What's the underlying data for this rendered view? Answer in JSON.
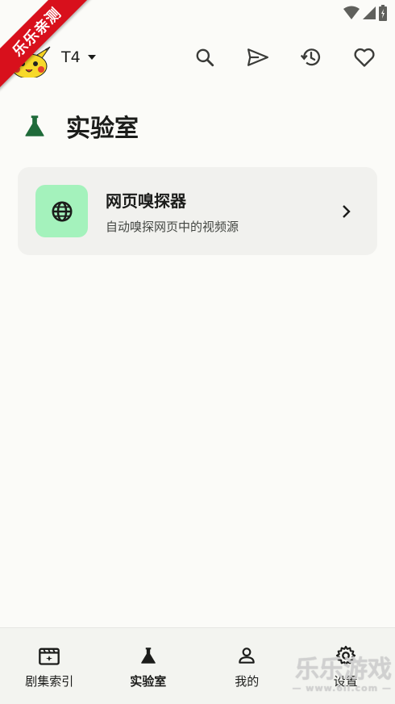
{
  "ribbon": {
    "text": "乐乐亲测"
  },
  "header": {
    "source_name": "T4"
  },
  "page": {
    "title": "实验室"
  },
  "card": {
    "title": "网页嗅探器",
    "subtitle": "自动嗅探网页中的视频源"
  },
  "nav": {
    "items": [
      {
        "label": "剧集索引",
        "icon": "movie-clapper-icon"
      },
      {
        "label": "实验室",
        "icon": "flask-icon",
        "active": true
      },
      {
        "label": "我的",
        "icon": "person-icon"
      },
      {
        "label": "设置",
        "icon": "gear-icon"
      }
    ]
  },
  "watermark": {
    "text": "乐乐游戏",
    "url": "— www.6ll.com —"
  },
  "colors": {
    "accent": "#1f6b3a",
    "card_icon_bg": "#a4f2bc",
    "ribbon": "#d8101c"
  }
}
